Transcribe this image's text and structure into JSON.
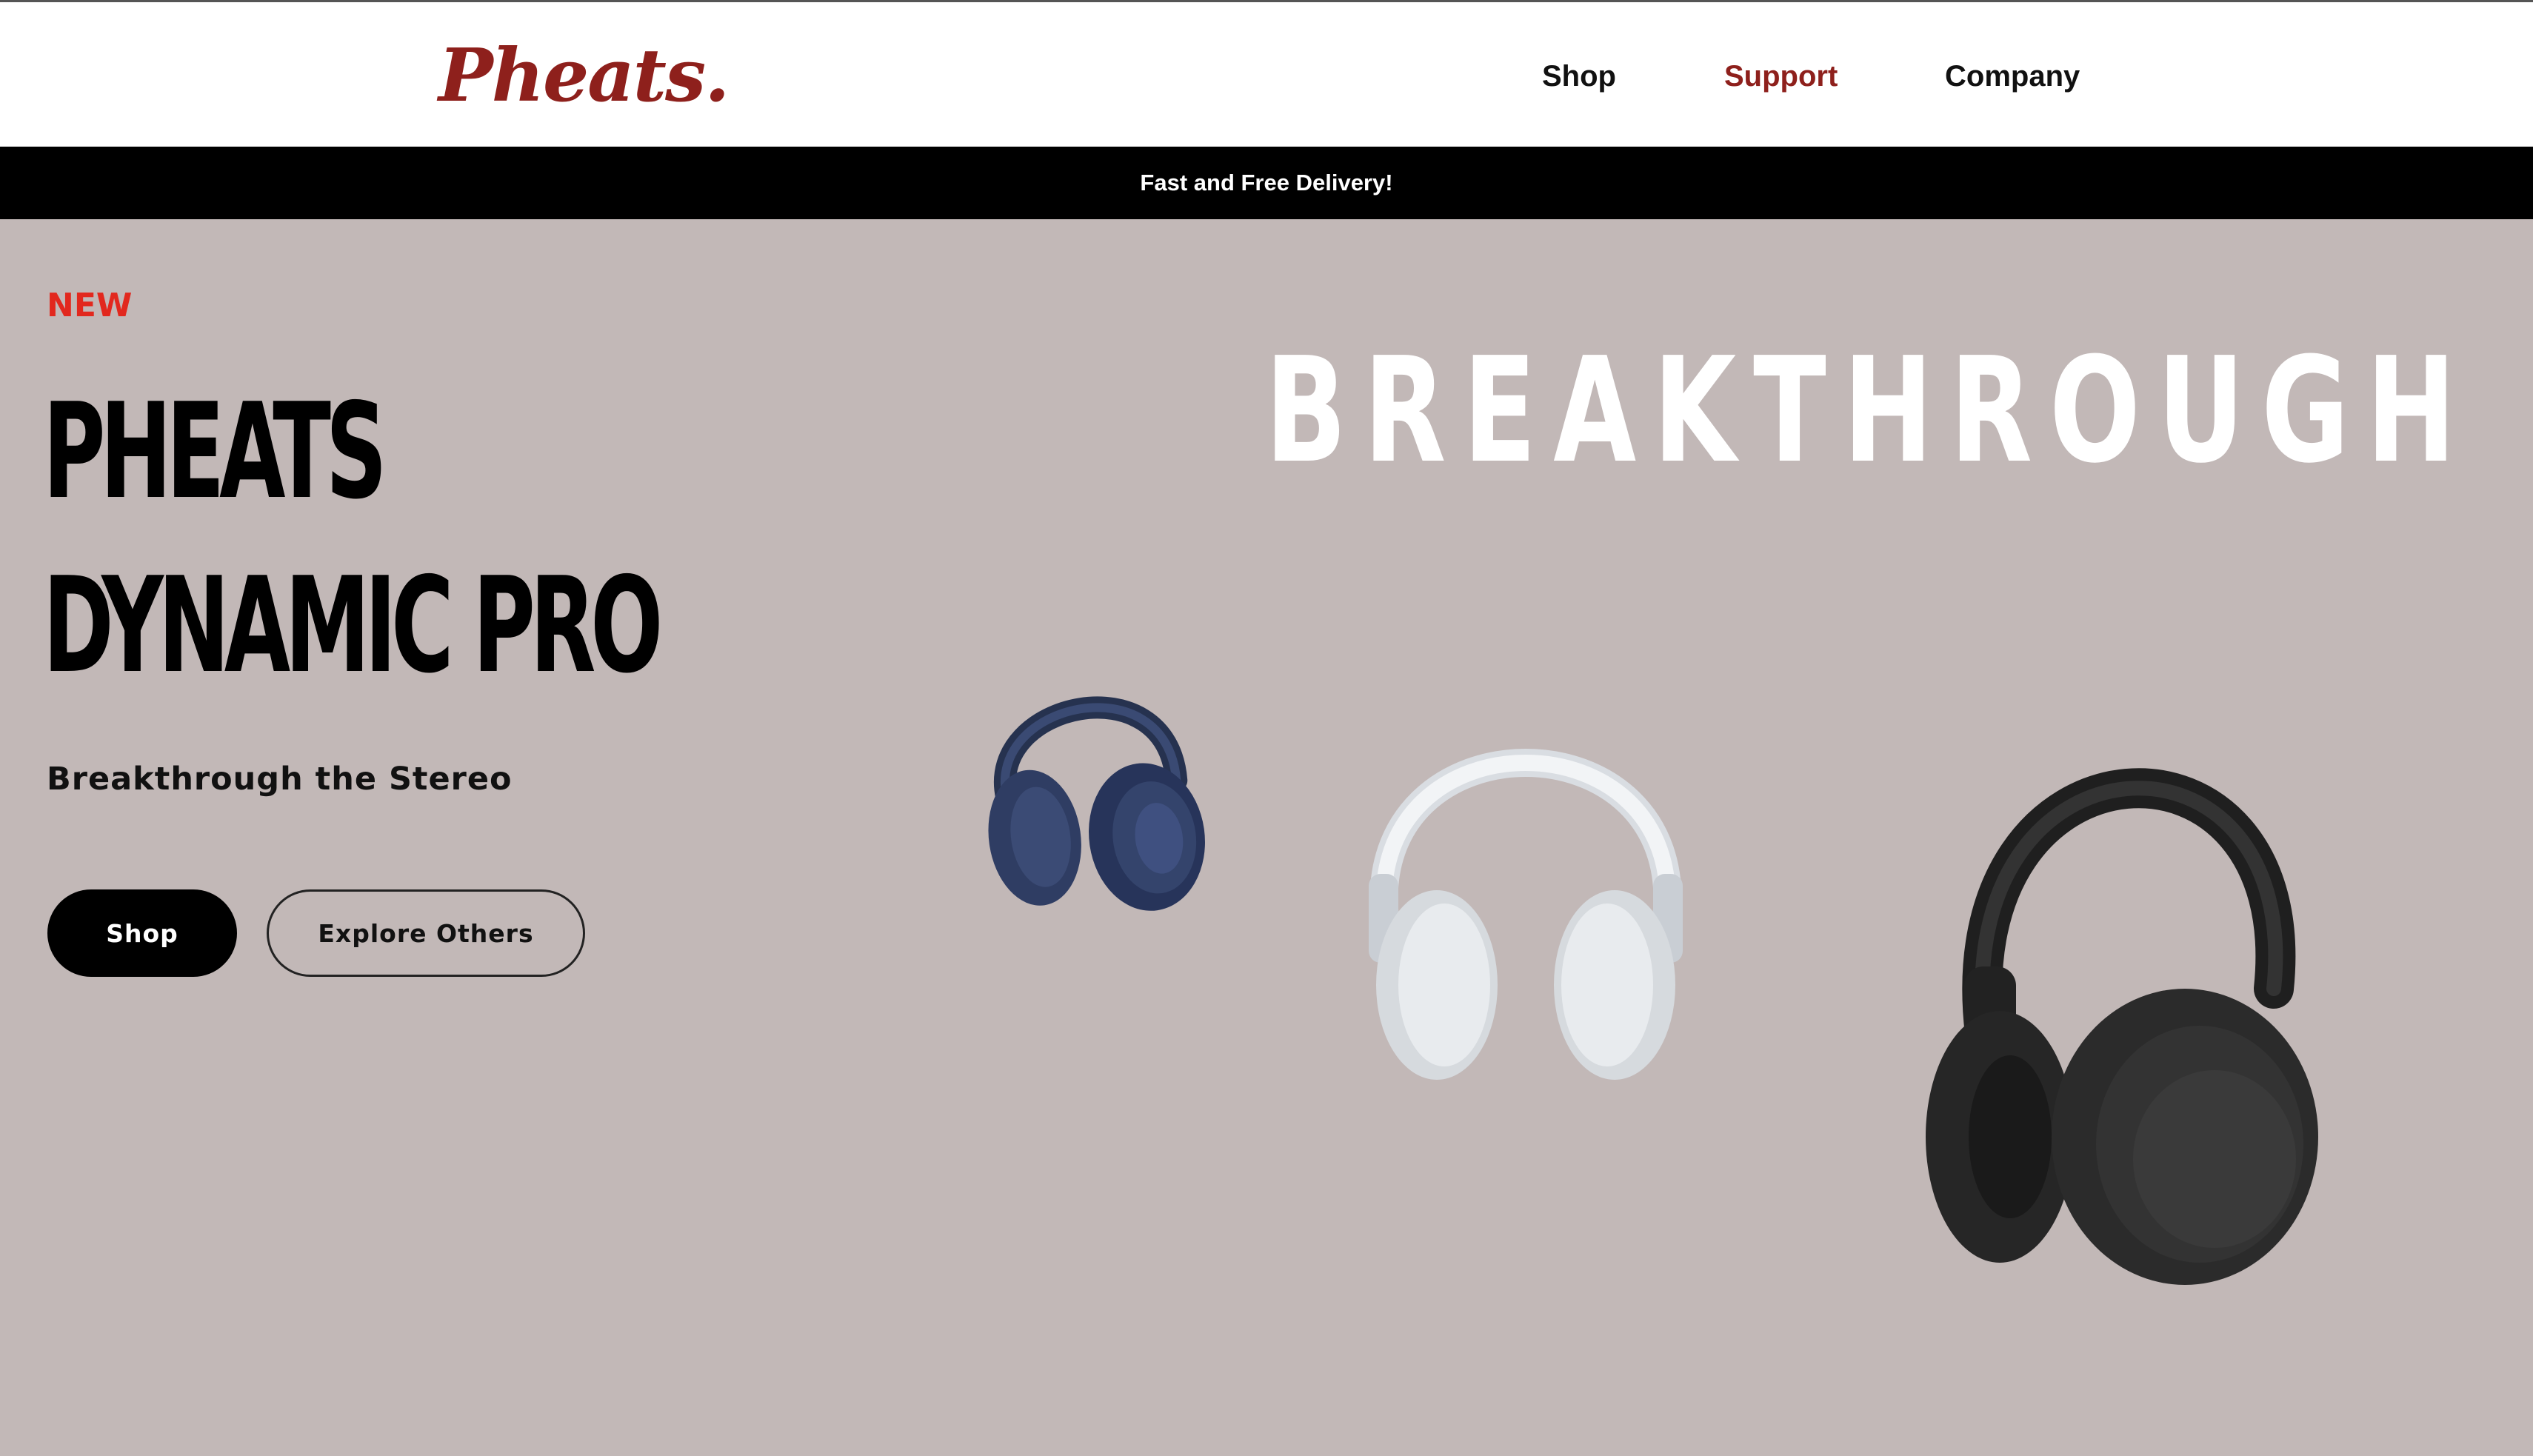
{
  "brand": {
    "logo": "Pheats."
  },
  "nav": {
    "items": [
      {
        "label": "Shop"
      },
      {
        "label": "Support"
      },
      {
        "label": "Company"
      }
    ],
    "active": "Support"
  },
  "promo": {
    "text": "Fast and Free Delivery!"
  },
  "hero": {
    "badge": "NEW",
    "title_line1": "PHEATS",
    "title_line2": "DYNAMIC PRO",
    "tagline": "Breakthrough the Stereo",
    "headline": "BREAKTHROUGH",
    "buttons": {
      "shop": "Shop",
      "explore": "Explore Others"
    },
    "products": [
      {
        "name": "navy-headphones-image",
        "color": "#2c3a5e"
      },
      {
        "name": "white-headphones-image",
        "color": "#e9ecef"
      },
      {
        "name": "black-headphones-image",
        "color": "#2a2a2a"
      }
    ]
  },
  "colors": {
    "brand_red": "#8e201c",
    "badge_red": "#e2281e",
    "hero_bg": "#c2b8b7",
    "promo_bg": "#000000"
  }
}
